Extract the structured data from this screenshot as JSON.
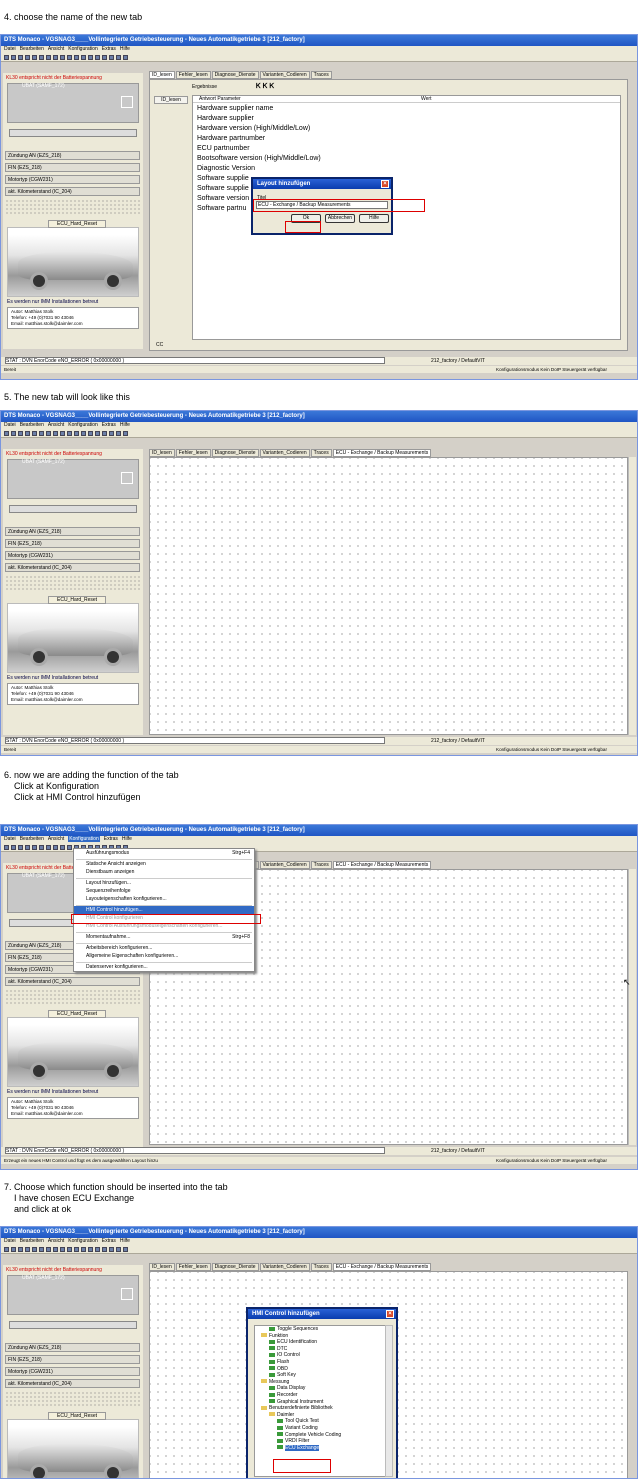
{
  "steps": [
    {
      "caption": "4. choose the name of the new tab"
    },
    {
      "caption": "5. The new tab will look like this"
    },
    {
      "caption": "6. now we are adding the function of the tab\n    Click at Konfiguration\n    Click at HMI Control hinzufügen"
    },
    {
      "caption": "7. Choose which function should be inserted into the tab\n    I have chosen ECU Exchange\n    and click at ok"
    }
  ],
  "app": {
    "title": "DTS Monaco - VGSNAG3____Vollintegrierte Getriebesteuerung - Neues Automatikgetriebe 3 [212_factory]",
    "menu": [
      "Datei",
      "Bearbeiten",
      "Ansicht",
      "Konfiguration",
      "Extras",
      "Hilfe"
    ],
    "battery_warning": "KL30 entspricht nicht der Batteriespannung",
    "ubat_label": "UBAT (SAMF_172)",
    "fields": [
      "Zündung AN (EZS_218)",
      "FIN (EZS_218)",
      "Motortyp (CGW231)",
      "akt. Kilometerstand (IC_204)"
    ],
    "ecu_panel": "ECU_Hard_Reset",
    "imm_note": "Es werden nur IMM Installationen betreut",
    "author": "Autor:     Matthias Stolk",
    "phone": "Telefon:  +49 (0)7031 90 43046",
    "email": "Email:      matthias.stolk@daimler.com",
    "status": "STAT : DVN  EnorCode  eNO_ERROR  ( 0x00000000 )",
    "factory": "212_factory / DefaultVIT",
    "footer_left": "Bereit",
    "footer_left_step6": "Erzeugt ein neues HMI Control und fügt es dem ausgewählten Layout hinzu",
    "footer_right": "Konfigurationsmodus  Kein DoIP Steuergerät verfügbar",
    "tabs": [
      "ID_lesen",
      "Fehler_lesen",
      "Diagnose_Dienste",
      "Varianten_Codieren",
      "Traces"
    ],
    "new_tab": "ECU - Exchange / Backup Measurements"
  },
  "step4": {
    "results_label": "Ergebnisse",
    "id_button": "ID_lesen",
    "col_param": "Antwort Parameter",
    "col_value": "Wert",
    "params": [
      "Hardware supplier name",
      "Hardware supplier",
      "Hardware version (High/Middle/Low)",
      "Hardware partnumber",
      "ECU partnumber",
      "Bootsoftware version (High/Middle/Low)",
      "Diagnostic Version",
      "Software supplie",
      "Software supplie",
      "Software version",
      "Software partnu"
    ],
    "cc": "CC",
    "dialog": {
      "title": "Layout hinzufügen",
      "field_label": "Titel",
      "field_value": "ECU - Exchange / Backup Measurements",
      "ok": "Ok",
      "cancel": "Abbrechen",
      "help": "Hilfe"
    }
  },
  "step6": {
    "menu": [
      {
        "label": "Ausführungsmodus",
        "shortcut": "Strg+F4"
      },
      {
        "label": "Statische Ansicht anzeigen"
      },
      {
        "label": "Dienstbaum anzeigen"
      },
      {
        "label": "Layout hinzufügen..."
      },
      {
        "label": "Sequenzreihenfolge"
      },
      {
        "label": "Layouteigenschaften konfigurieren..."
      },
      {
        "label": "HMI Control hinzufügen..."
      },
      {
        "label": "HMI Control konfigurieren"
      },
      {
        "label": "HMI Control Ausführungsmoduseigenschaften konfigurieren..."
      },
      {
        "label": "Momentaufnahme...",
        "shortcut": "Strg+F8"
      },
      {
        "label": "Arbeitsbereich konfigurieren..."
      },
      {
        "label": "Allgemeine Eigenschaften konfigurieren..."
      },
      {
        "label": "Datenserver konfigurieren..."
      }
    ]
  },
  "step7": {
    "dialog_title": "HMI Control hinzufügen",
    "tree": [
      "Toggle Sequences",
      "Funktion",
      "ECU Identification",
      "DTC",
      "IO Control",
      "Flash",
      "OBD",
      "Soft Key",
      "Messung",
      "Data Display",
      "Recorder",
      "Graphical Instrument",
      "Benutzerdefinierte Bibliothek",
      "Daimler",
      "Tool Quick Test",
      "Variant Coding",
      "Complete Vehicle Coding",
      "VRDI Filter",
      "ECU Exchange"
    ]
  }
}
